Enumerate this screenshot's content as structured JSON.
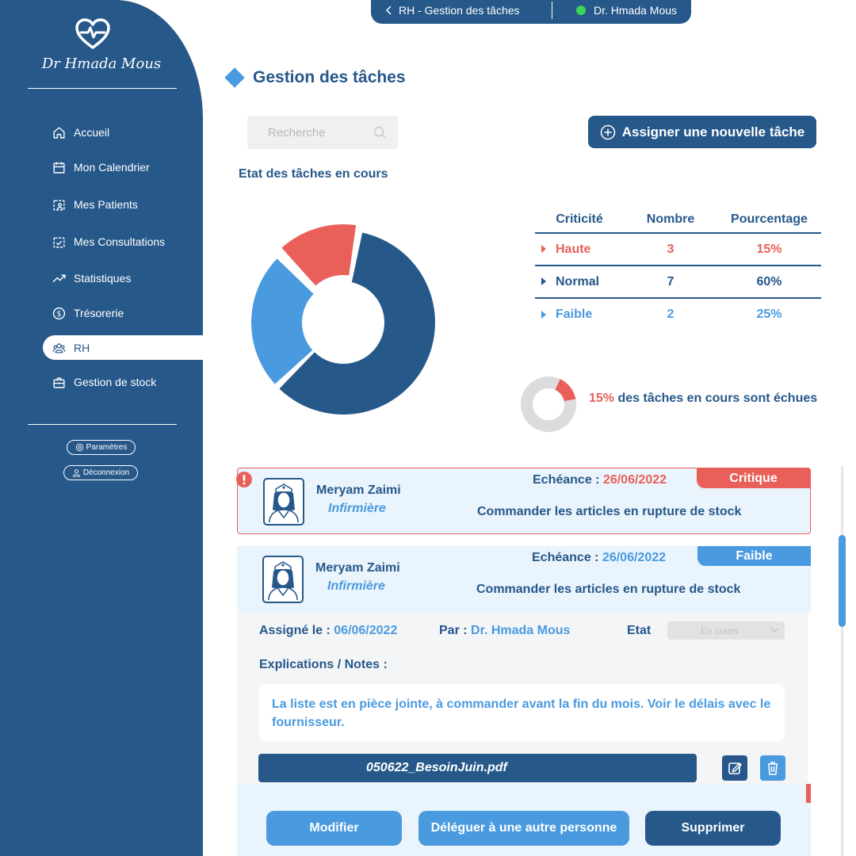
{
  "brand": {
    "name": "Dr Hmada Mous",
    "logo_icon": "heart-pulse-icon"
  },
  "topbar": {
    "breadcrumb": "RH - Gestion des tâches",
    "user": "Dr. Hmada Mous",
    "status_color": "#39d454"
  },
  "sidebar": {
    "items": [
      {
        "label": "Accueil",
        "icon": "home-icon"
      },
      {
        "label": "Mon Calendrier",
        "icon": "calendar-icon"
      },
      {
        "label": "Mes Patients",
        "icon": "patients-icon"
      },
      {
        "label": "Mes Consultations",
        "icon": "consultation-icon"
      },
      {
        "label": "Statistiques",
        "icon": "trend-icon"
      },
      {
        "label": "Trésorerie",
        "icon": "dollar-icon"
      },
      {
        "label": "RH",
        "icon": "team-icon",
        "active": true
      },
      {
        "label": "Gestion de stock",
        "icon": "box-icon"
      }
    ],
    "settings": "Paramètres",
    "logout": "Déconnexion"
  },
  "page": {
    "title": "Gestion des tâches",
    "search_placeholder": "Recherche",
    "assign_button": "Assigner une nouvelle tâche",
    "section_title": "Etat des tâches en cours"
  },
  "criticality_table": {
    "headers": [
      "Criticité",
      "Nombre",
      "Pourcentage"
    ],
    "rows": [
      {
        "label": "Haute",
        "count": "3",
        "percent": "15%",
        "color": "#e9605a"
      },
      {
        "label": "Normal",
        "count": "7",
        "percent": "60%",
        "color": "#26588a"
      },
      {
        "label": "Faible",
        "count": "2",
        "percent": "25%",
        "color": "#4a9ae0"
      }
    ]
  },
  "chart_data": {
    "type": "pie",
    "donut": true,
    "categories": [
      "Haute",
      "Normal",
      "Faible"
    ],
    "values": [
      15,
      60,
      25
    ],
    "colors": [
      "#e9605a",
      "#26588a",
      "#4a9ae0"
    ]
  },
  "overdue": {
    "percent": "15%",
    "text": "des tâches en cours sont échues",
    "value": 0.15
  },
  "tasks": [
    {
      "name": "Meryam Zaimi",
      "role": "Infirmière",
      "deadline_label": "Echéance :",
      "deadline": "26/06/2022",
      "description": "Commander les articles en rupture de stock",
      "badge": "Critique"
    },
    {
      "name": "Meryam Zaimi",
      "role": "Infirmière",
      "deadline_label": "Echéance :",
      "deadline": "26/06/2022",
      "description": "Commander les articles en rupture de stock",
      "badge": "Faible"
    }
  ],
  "detail": {
    "assigned_label": "Assigné le :",
    "assigned_date": "06/06/2022",
    "by_label": "Par :",
    "by_name": "Dr. Hmada Mous",
    "state_label": "Etat",
    "state_value": "En cours",
    "notes_label": "Explications / Notes :",
    "notes": "La liste est en pièce jointe, à commander avant la fin du mois. Voir le délais avec le fournisseur.",
    "file": "050622_BesoinJuin.pdf",
    "buttons": {
      "modify": "Modifier",
      "delegate": "Déléguer à une autre personne",
      "delete": "Supprimer"
    }
  }
}
